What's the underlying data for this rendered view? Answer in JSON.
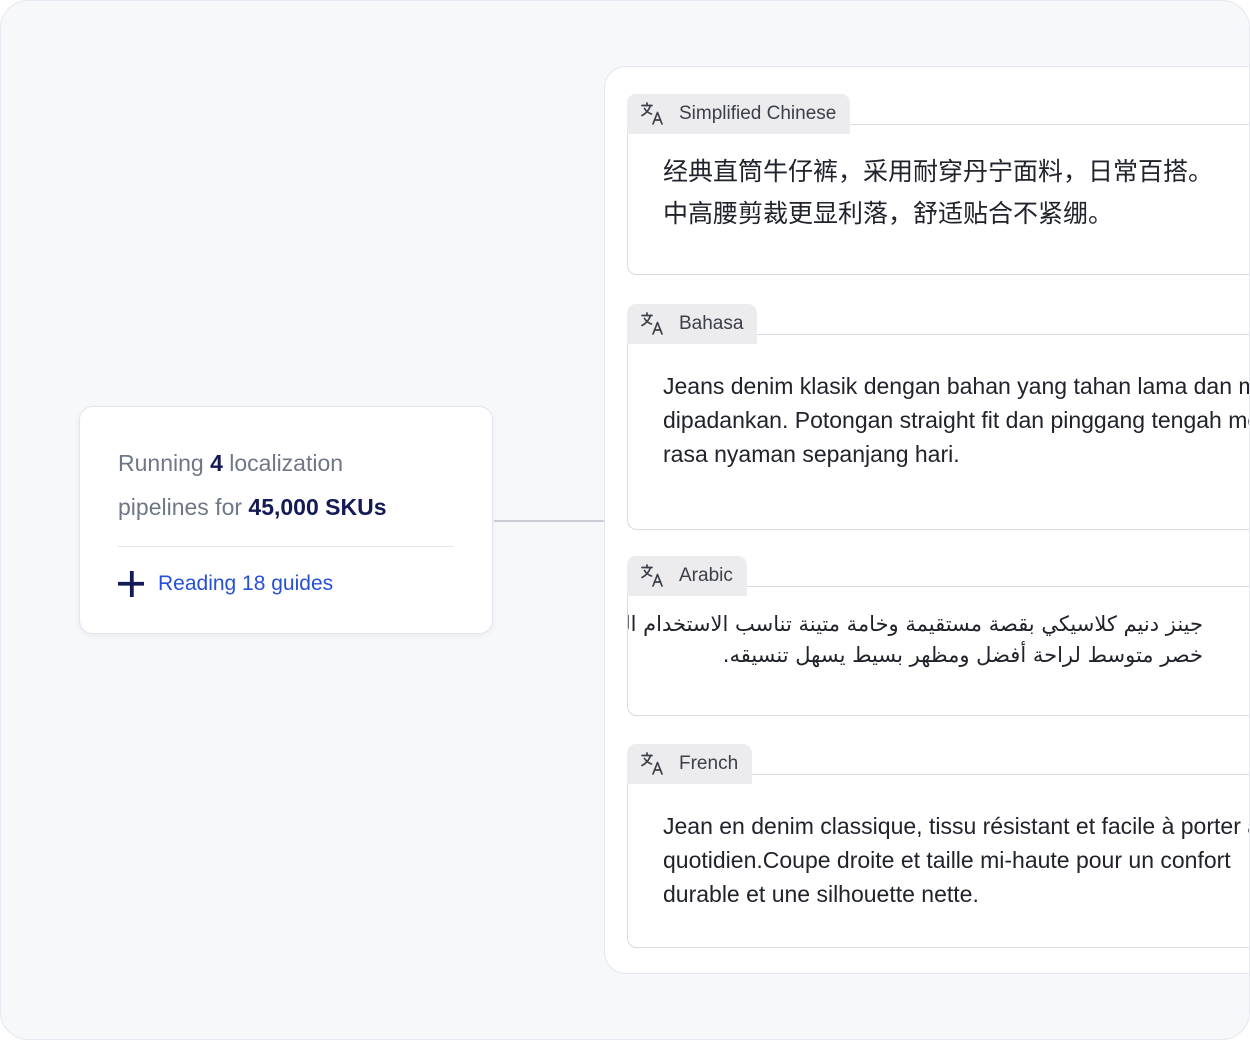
{
  "status": {
    "line1_prefix": "Running",
    "pipeline_count": "4",
    "line1_suffix": "localization",
    "line2_prefix": "pipelines for",
    "sku_count": "45,000 SKUs",
    "reading_label": "Reading 18 guides",
    "reading_icon": "sparkle-icon"
  },
  "colors": {
    "accent_blue": "#2650d6",
    "emphasis_navy": "#141a55",
    "muted_text": "#6f7787",
    "tab_bg": "#ececee"
  },
  "translations": [
    {
      "language": "Simplified Chinese",
      "icon": "translate-icon",
      "text": "经典直筒牛仔裤，采用耐穿丹宁面料，日常百搭。\n中高腰剪裁更显利落，舒适贴合不紧绷。"
    },
    {
      "language": "Bahasa",
      "icon": "translate-icon",
      "text": "Jeans denim klasik dengan bahan yang tahan lama dan mudah\ndipadankan. Potongan straight fit dan pinggang tengah memberi\nrasa nyaman sepanjang hari."
    },
    {
      "language": "Arabic",
      "icon": "translate-icon",
      "text": "جينز دنيم كلاسيكي بقصة مستقيمة وخامة متينة تناسب الاستخدام اليومي.\nخصر متوسط لراحة أفضل ومظهر بسيط يسهل تنسيقه."
    },
    {
      "language": "French",
      "icon": "translate-icon",
      "text": "Jean en denim classique, tissu résistant et facile à porter au\nquotidien.Coupe droite et taille mi-haute pour un confort\ndurable et une silhouette nette."
    }
  ]
}
